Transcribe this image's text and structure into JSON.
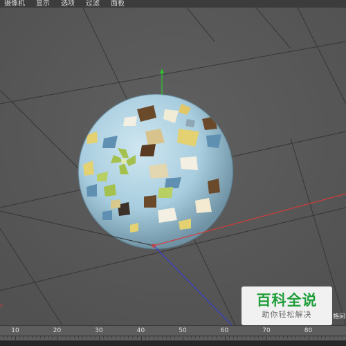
{
  "menu": {
    "items": [
      "摄像机",
      "显示",
      "选项",
      "过滤",
      "面板"
    ]
  },
  "viewport": {
    "background_color": "#5a5a5a",
    "grid_color": "#333333",
    "axis_colors": {
      "x": "#d33b3b",
      "y": "#2fc22f",
      "z": "#3b3bd3"
    },
    "object": "textured-sphere",
    "sphere_base_color": "#a9cfe0"
  },
  "timeline": {
    "ticks": [
      "10",
      "20",
      "30",
      "40",
      "50",
      "60",
      "70",
      "80"
    ]
  },
  "watermark": {
    "title": "百科全说",
    "subtitle": "助你轻松解决"
  },
  "side_label": "格间"
}
